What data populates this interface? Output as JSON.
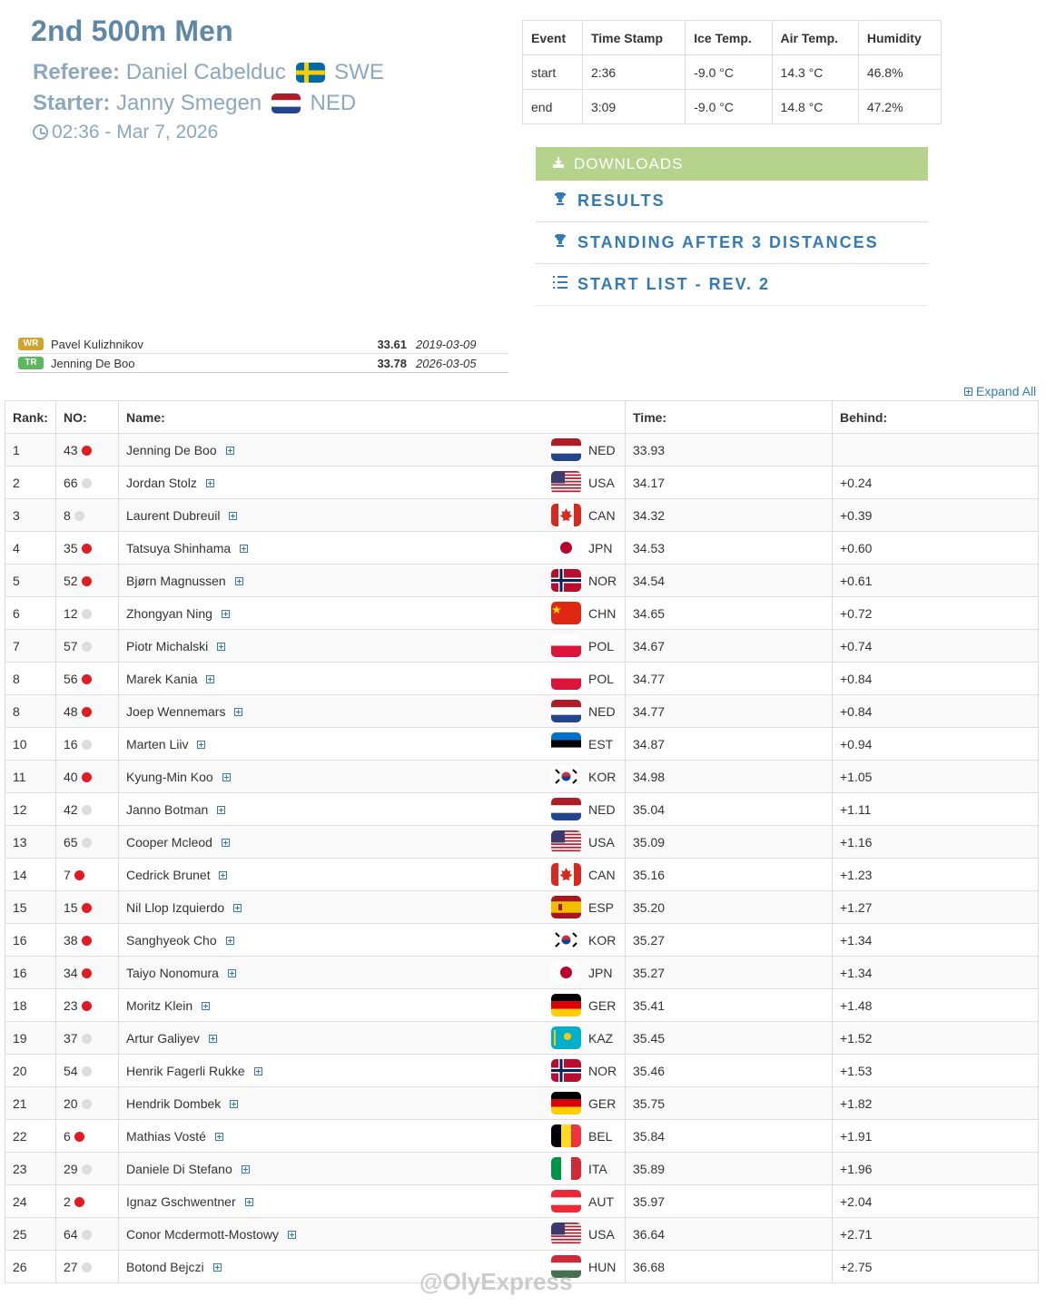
{
  "header": {
    "title": "2nd 500m Men",
    "referee_label": "Referee:",
    "referee_name": "Daniel Cabelduc",
    "referee_country": "SWE",
    "starter_label": "Starter:",
    "starter_name": "Janny Smegen",
    "starter_country": "NED",
    "datetime": "02:36 - Mar 7, 2026"
  },
  "conditions": {
    "headers": [
      "Event",
      "Time Stamp",
      "Ice Temp.",
      "Air Temp.",
      "Humidity"
    ],
    "rows": [
      [
        "start",
        "2:36",
        "-9.0 °C",
        "14.3 °C",
        "46.8%"
      ],
      [
        "end",
        "3:09",
        "-9.0 °C",
        "14.8 °C",
        "47.2%"
      ]
    ]
  },
  "actions": {
    "downloads": "DOWNLOADS",
    "results": "RESULTS",
    "standing": "STANDING AFTER 3 DISTANCES",
    "start_list": "START LIST - REV. 2"
  },
  "records": [
    {
      "badge": "WR",
      "name": "Pavel Kulizhnikov",
      "time": "33.61",
      "date": "2019-03-09"
    },
    {
      "badge": "TR",
      "name": "Jenning De Boo",
      "time": "33.78",
      "date": "2026-03-05"
    }
  ],
  "expand_all": "Expand All",
  "results_table": {
    "headers": [
      "Rank:",
      "NO:",
      "Name:",
      "Time:",
      "Behind:"
    ],
    "rows": [
      {
        "rank": "1",
        "no": "43",
        "dot": "red",
        "name": "Jenning De Boo",
        "country": "NED",
        "time": "33.93",
        "behind": ""
      },
      {
        "rank": "2",
        "no": "66",
        "dot": "gray",
        "name": "Jordan Stolz",
        "country": "USA",
        "time": "34.17",
        "behind": "+0.24"
      },
      {
        "rank": "3",
        "no": "8",
        "dot": "gray",
        "name": "Laurent Dubreuil",
        "country": "CAN",
        "time": "34.32",
        "behind": "+0.39"
      },
      {
        "rank": "4",
        "no": "35",
        "dot": "red",
        "name": "Tatsuya Shinhama",
        "country": "JPN",
        "time": "34.53",
        "behind": "+0.60"
      },
      {
        "rank": "5",
        "no": "52",
        "dot": "red",
        "name": "Bjørn Magnussen",
        "country": "NOR",
        "time": "34.54",
        "behind": "+0.61"
      },
      {
        "rank": "6",
        "no": "12",
        "dot": "gray",
        "name": "Zhongyan Ning",
        "country": "CHN",
        "time": "34.65",
        "behind": "+0.72"
      },
      {
        "rank": "7",
        "no": "57",
        "dot": "gray",
        "name": "Piotr Michalski",
        "country": "POL",
        "time": "34.67",
        "behind": "+0.74"
      },
      {
        "rank": "8",
        "no": "56",
        "dot": "red",
        "name": "Marek Kania",
        "country": "POL",
        "time": "34.77",
        "behind": "+0.84"
      },
      {
        "rank": "8",
        "no": "48",
        "dot": "red",
        "name": "Joep Wennemars",
        "country": "NED",
        "time": "34.77",
        "behind": "+0.84"
      },
      {
        "rank": "10",
        "no": "16",
        "dot": "gray",
        "name": "Marten Liiv",
        "country": "EST",
        "time": "34.87",
        "behind": "+0.94"
      },
      {
        "rank": "11",
        "no": "40",
        "dot": "red",
        "name": "Kyung-Min Koo",
        "country": "KOR",
        "time": "34.98",
        "behind": "+1.05"
      },
      {
        "rank": "12",
        "no": "42",
        "dot": "gray",
        "name": "Janno Botman",
        "country": "NED",
        "time": "35.04",
        "behind": "+1.11"
      },
      {
        "rank": "13",
        "no": "65",
        "dot": "gray",
        "name": "Cooper Mcleod",
        "country": "USA",
        "time": "35.09",
        "behind": "+1.16"
      },
      {
        "rank": "14",
        "no": "7",
        "dot": "red",
        "name": "Cedrick Brunet",
        "country": "CAN",
        "time": "35.16",
        "behind": "+1.23"
      },
      {
        "rank": "15",
        "no": "15",
        "dot": "red",
        "name": "Nil Llop Izquierdo",
        "country": "ESP",
        "time": "35.20",
        "behind": "+1.27"
      },
      {
        "rank": "16",
        "no": "38",
        "dot": "red",
        "name": "Sanghyeok Cho",
        "country": "KOR",
        "time": "35.27",
        "behind": "+1.34"
      },
      {
        "rank": "16",
        "no": "34",
        "dot": "red",
        "name": "Taiyo Nonomura",
        "country": "JPN",
        "time": "35.27",
        "behind": "+1.34"
      },
      {
        "rank": "18",
        "no": "23",
        "dot": "red",
        "name": "Moritz Klein",
        "country": "GER",
        "time": "35.41",
        "behind": "+1.48"
      },
      {
        "rank": "19",
        "no": "37",
        "dot": "gray",
        "name": "Artur Galiyev",
        "country": "KAZ",
        "time": "35.45",
        "behind": "+1.52"
      },
      {
        "rank": "20",
        "no": "54",
        "dot": "gray",
        "name": "Henrik Fagerli Rukke",
        "country": "NOR",
        "time": "35.46",
        "behind": "+1.53"
      },
      {
        "rank": "21",
        "no": "20",
        "dot": "gray",
        "name": "Hendrik Dombek",
        "country": "GER",
        "time": "35.75",
        "behind": "+1.82"
      },
      {
        "rank": "22",
        "no": "6",
        "dot": "red",
        "name": "Mathias Vosté",
        "country": "BEL",
        "time": "35.84",
        "behind": "+1.91"
      },
      {
        "rank": "23",
        "no": "29",
        "dot": "gray",
        "name": "Daniele Di Stefano",
        "country": "ITA",
        "time": "35.89",
        "behind": "+1.96"
      },
      {
        "rank": "24",
        "no": "2",
        "dot": "red",
        "name": "Ignaz Gschwentner",
        "country": "AUT",
        "time": "35.97",
        "behind": "+2.04"
      },
      {
        "rank": "25",
        "no": "64",
        "dot": "gray",
        "name": "Conor Mcdermott-Mostowy",
        "country": "USA",
        "time": "36.64",
        "behind": "+2.71"
      },
      {
        "rank": "26",
        "no": "27",
        "dot": "gray",
        "name": "Botond Bejczi",
        "country": "HUN",
        "time": "36.68",
        "behind": "+2.75"
      }
    ]
  },
  "watermark": "@OlyExpress",
  "colors": {
    "title": "#5f88a6",
    "accent_link": "#337ab7",
    "downloads_bg": "#b5d38c",
    "wr_badge": "#d4a22e",
    "tr_badge": "#5cb85c",
    "red_dot": "#e31b23",
    "gray_dot": "#dddddd"
  }
}
